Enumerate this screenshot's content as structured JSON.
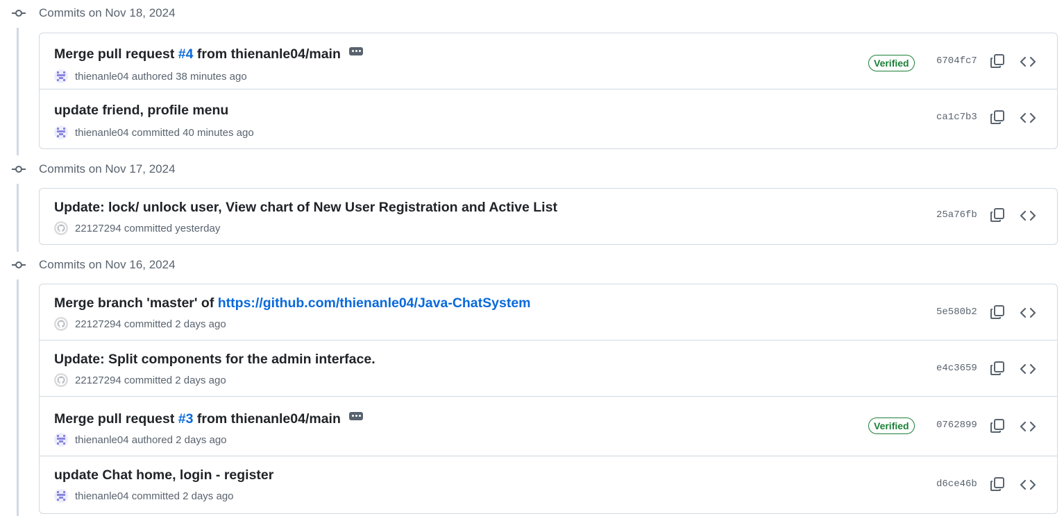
{
  "groups": [
    {
      "title": "Commits on Nov 18, 2024",
      "commits": [
        {
          "parts": [
            "Merge pull request ",
            "#4",
            " from thienanle04/main"
          ],
          "has_dots": true,
          "avatar": "identicon",
          "author": "thienanle04",
          "action": "authored",
          "time": "38 minutes ago",
          "verified": "Verified",
          "sha": "6704fc7"
        },
        {
          "parts": [
            "update friend, profile menu"
          ],
          "has_dots": false,
          "avatar": "identicon",
          "author": "thienanle04",
          "action": "committed",
          "time": "40 minutes ago",
          "verified": "",
          "sha": "ca1c7b3"
        }
      ]
    },
    {
      "title": "Commits on Nov 17, 2024",
      "commits": [
        {
          "parts": [
            "Update: lock/ unlock user, View chart of New User Registration and Active List"
          ],
          "has_dots": false,
          "avatar": "github",
          "author": "22127294",
          "action": "committed",
          "time": "yesterday",
          "verified": "",
          "sha": "25a76fb"
        }
      ]
    },
    {
      "title": "Commits on Nov 16, 2024",
      "commits": [
        {
          "parts": [
            "Merge branch 'master' of ",
            "https://github.com/thienanle04/Java-ChatSystem"
          ],
          "has_dots": false,
          "avatar": "github",
          "author": "22127294",
          "action": "committed",
          "time": "2 days ago",
          "verified": "",
          "sha": "5e580b2"
        },
        {
          "parts": [
            "Update: Split components for the admin interface."
          ],
          "has_dots": false,
          "avatar": "github",
          "author": "22127294",
          "action": "committed",
          "time": "2 days ago",
          "verified": "",
          "sha": "e4c3659"
        },
        {
          "parts": [
            "Merge pull request ",
            "#3",
            " from thienanle04/main"
          ],
          "has_dots": true,
          "avatar": "identicon",
          "author": "thienanle04",
          "action": "authored",
          "time": "2 days ago",
          "verified": "Verified",
          "sha": "0762899"
        },
        {
          "parts": [
            "update Chat home, login - register"
          ],
          "has_dots": false,
          "avatar": "identicon",
          "author": "thienanle04",
          "action": "committed",
          "time": "2 days ago",
          "verified": "",
          "sha": "d6ce46b"
        }
      ]
    }
  ],
  "colors": {
    "link": "#0969da",
    "verified": "#1a7f37",
    "muted": "#59636e",
    "border": "#d1d9e0"
  },
  "icons": {
    "group": "git-commit-icon",
    "copy": "copy-icon",
    "browse": "code-icon",
    "ellipsis": "ellipsis-icon"
  }
}
